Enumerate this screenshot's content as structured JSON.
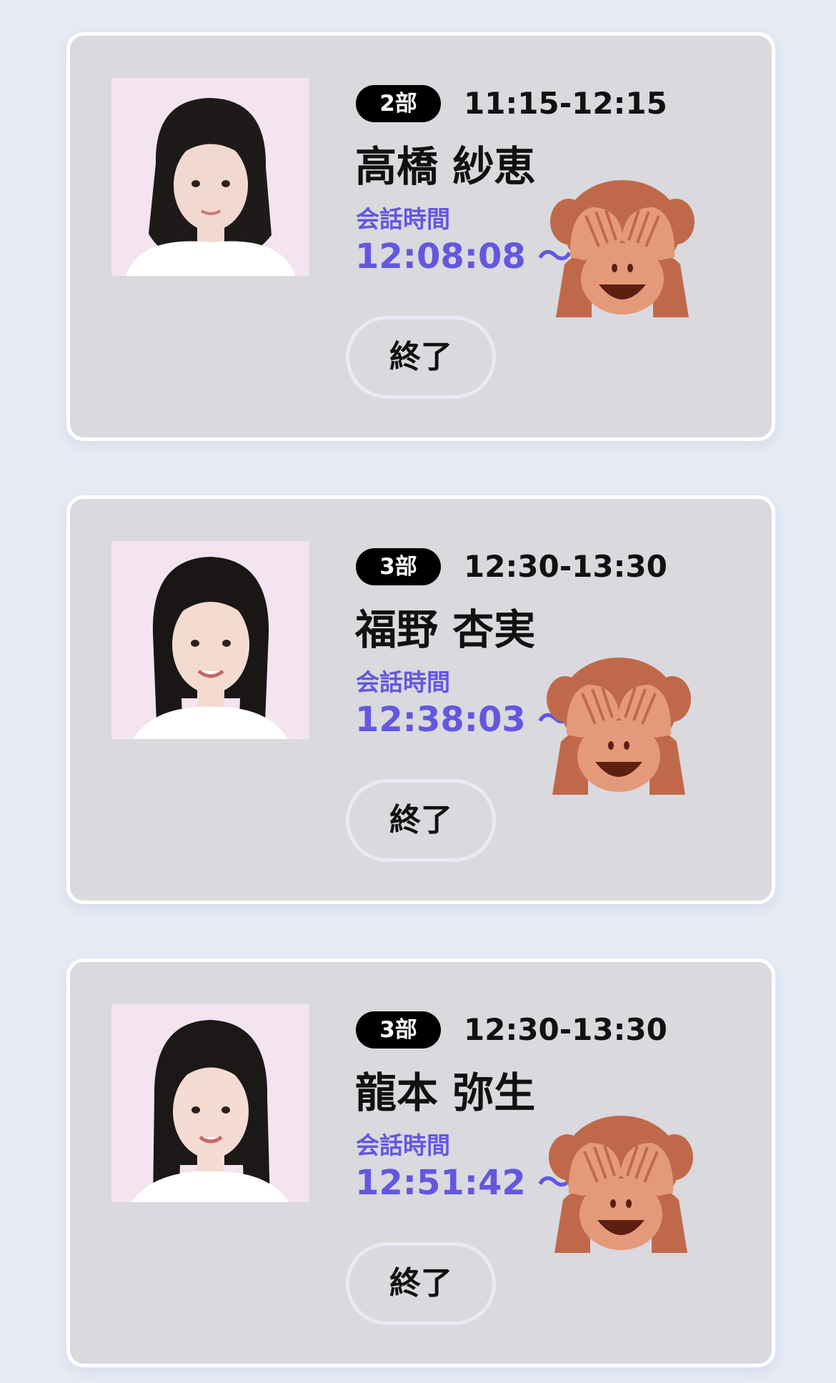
{
  "cards": [
    {
      "part_badge": "2部",
      "slot_time": "11:15-12:15",
      "member_name": "高橋 紗恵",
      "talk_label": "会話時間",
      "talk_time": "12:08:08 〜 1",
      "end_label": "終了"
    },
    {
      "part_badge": "3部",
      "slot_time": "12:30-13:30",
      "member_name": "福野 杏実",
      "talk_label": "会話時間",
      "talk_time": "12:38:03 〜 1",
      "end_label": "終了"
    },
    {
      "part_badge": "3部",
      "slot_time": "12:30-13:30",
      "member_name": "龍本 弥生",
      "talk_label": "会話時間",
      "talk_time": "12:51:42 〜 1",
      "end_label": "終了"
    }
  ],
  "overlay_icon": "see-no-evil-monkey",
  "colors": {
    "page_background": "#e6ebf5",
    "card_background": "#d9d9de",
    "accent_purple": "#6357e0",
    "badge_black": "#000000"
  }
}
